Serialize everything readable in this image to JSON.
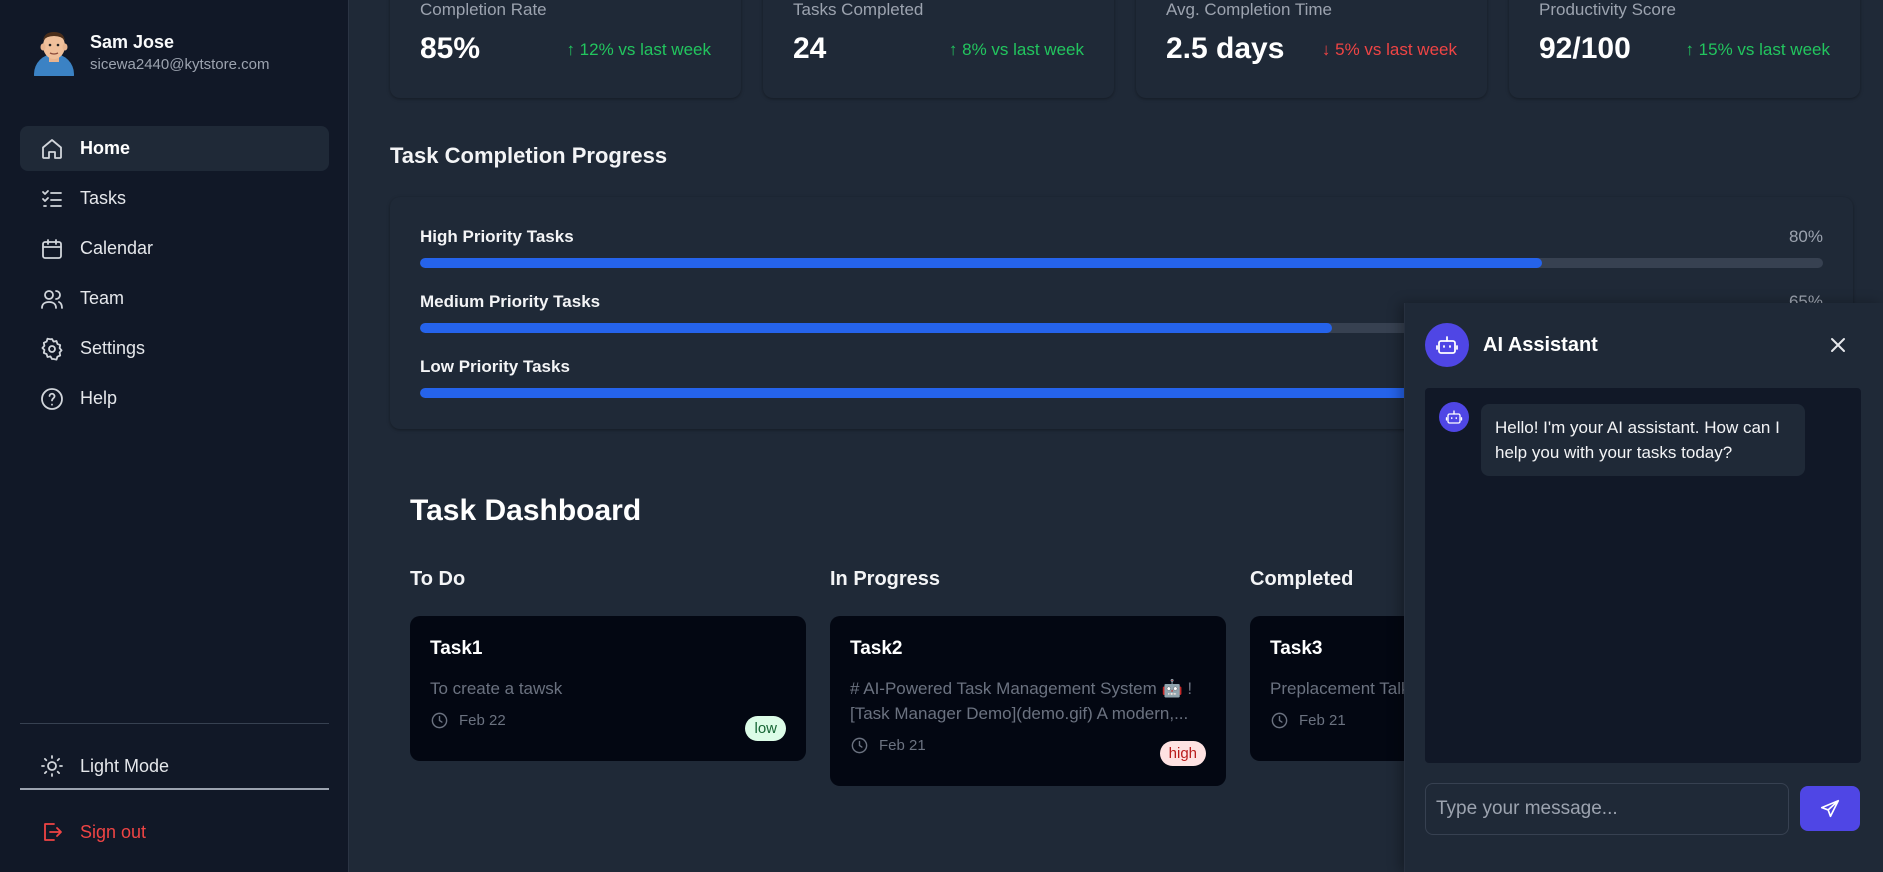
{
  "profile": {
    "name": "Sam Jose",
    "email": "sicewa2440@kytstore.com"
  },
  "nav": {
    "items": [
      {
        "label": "Home",
        "icon": "home-icon",
        "active": true
      },
      {
        "label": "Tasks",
        "icon": "list-check-icon"
      },
      {
        "label": "Calendar",
        "icon": "calendar-icon"
      },
      {
        "label": "Team",
        "icon": "users-icon"
      },
      {
        "label": "Settings",
        "icon": "gear-icon"
      },
      {
        "label": "Help",
        "icon": "help-circle-icon"
      }
    ],
    "light_mode": "Light Mode",
    "sign_out": "Sign out"
  },
  "stats": [
    {
      "label": "Completion Rate",
      "value": "85%",
      "change": "↑ 12% vs last week",
      "trend": "up"
    },
    {
      "label": "Tasks Completed",
      "value": "24",
      "change": "↑ 8% vs last week",
      "trend": "up"
    },
    {
      "label": "Avg. Completion Time",
      "value": "2.5 days",
      "change": "↓ 5% vs last week",
      "trend": "down"
    },
    {
      "label": "Productivity Score",
      "value": "92/100",
      "change": "↑ 15% vs last week",
      "trend": "up"
    }
  ],
  "progress": {
    "title": "Task Completion Progress",
    "rows": [
      {
        "label": "High Priority Tasks",
        "percent_text": "80%",
        "percent": 80
      },
      {
        "label": "Medium Priority Tasks",
        "percent_text": "65%",
        "percent": 65
      },
      {
        "label": "Low Priority Tasks",
        "percent_text": "",
        "percent": 95
      }
    ]
  },
  "dashboard": {
    "title": "Task Dashboard",
    "columns": [
      {
        "title": "To Do",
        "task": {
          "title": "Task1",
          "desc": "To create a tawsk",
          "date": "Feb 22",
          "priority": "low"
        }
      },
      {
        "title": "In Progress",
        "task": {
          "title": "Task2",
          "desc": "# AI-Powered Task Management System 🤖 ! [Task Manager Demo](demo.gif) A modern,...",
          "date": "Feb 21",
          "priority": "high"
        }
      },
      {
        "title": "Completed",
        "task": {
          "title": "Task3",
          "desc": "Preplacement Talk",
          "date": "Feb 21",
          "priority": ""
        }
      }
    ]
  },
  "assistant": {
    "title": "AI Assistant",
    "message": "Hello! I'm your AI assistant. How can I help you with your tasks today?",
    "input_placeholder": "Type your message..."
  },
  "colors": {
    "accent": "#2563eb",
    "assistant": "#4f46e5",
    "up": "#22c55e",
    "down": "#ef4444"
  }
}
